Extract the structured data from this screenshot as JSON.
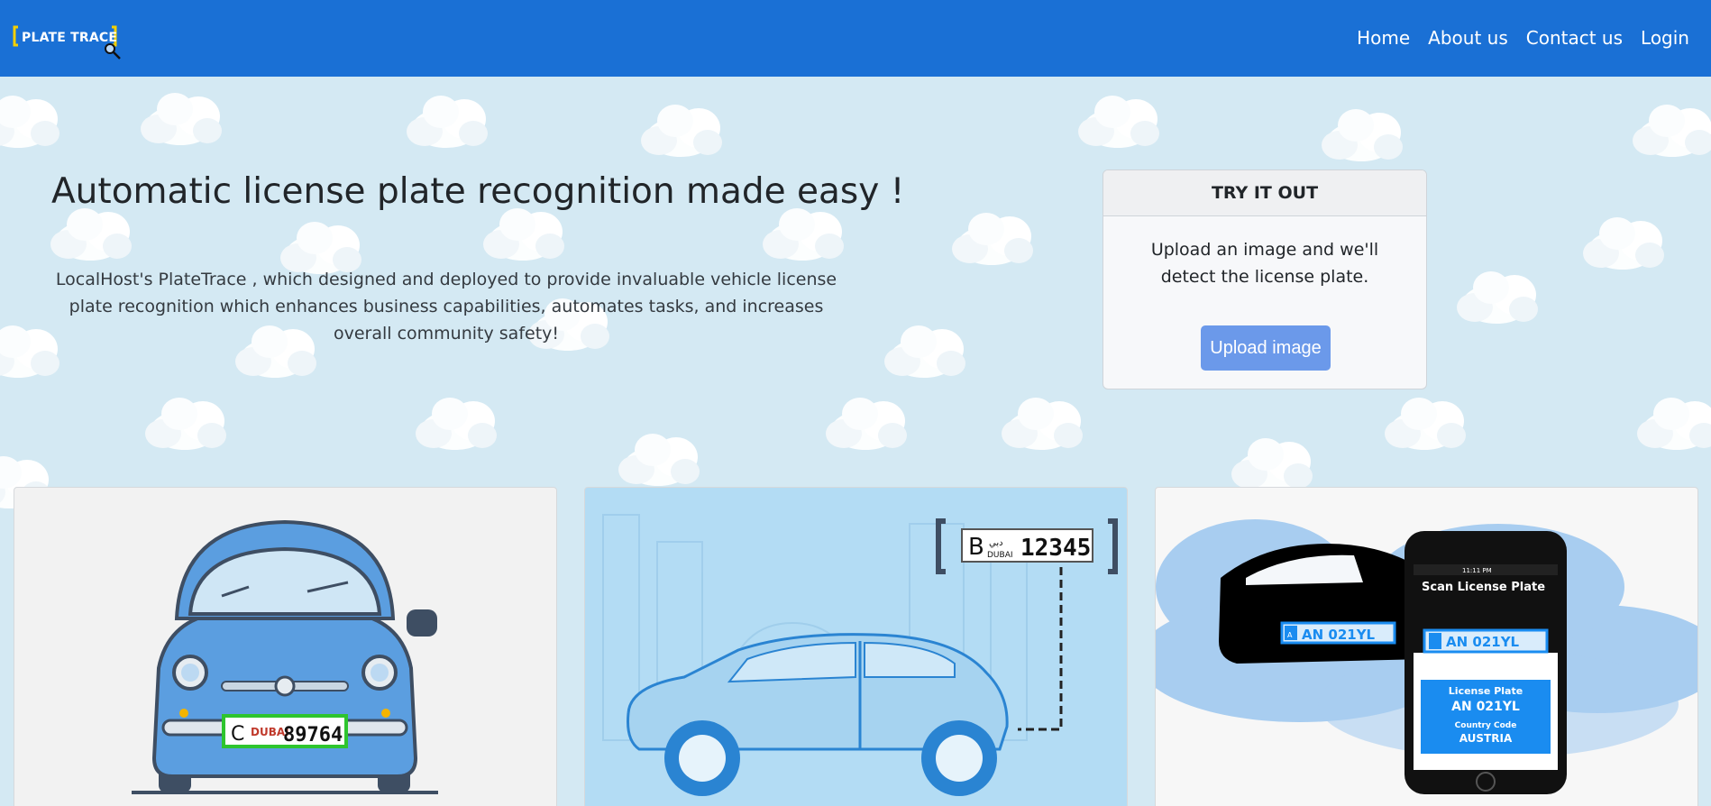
{
  "nav": {
    "logo_text": "PLATE TRACE",
    "links": [
      "Home",
      "About us",
      "Contact us",
      "Login"
    ]
  },
  "hero": {
    "title": "Automatic license plate recognition made easy !",
    "description": "LocalHost's PlateTrace , which designed and deployed to provide invaluable vehicle license plate recognition which enhances business capabilities, automates tasks, and increases overall community safety!"
  },
  "try_card": {
    "header": "TRY IT OUT",
    "text": "Upload an image and we'll detect the license plate.",
    "button": "Upload image"
  },
  "cards": {
    "card1": {
      "plate_prefix": "C",
      "plate_emirate": "DUBAI",
      "plate_number": "89764"
    },
    "card2": {
      "plate_letter": "B",
      "plate_arabic": "دبي",
      "plate_emirate": "DUBAI",
      "plate_number": "12345"
    },
    "card3": {
      "car_plate": "AN 021YL",
      "plate_flag": "A",
      "phone_time": "11:11 PM",
      "phone_title": "Scan License Plate",
      "detected_plate": "AN 021YL",
      "result_label": "License Plate",
      "result_plate": "AN 021YL",
      "country_label": "Country Code",
      "country": "AUSTRIA"
    }
  },
  "colors": {
    "navbar": "#1a70d5",
    "hero_bg": "#d4e9f3",
    "button": "#6b99ea",
    "logo_bracket": "#f5d000"
  },
  "icons": [
    "magnifier-icon",
    "cloud-icon"
  ]
}
